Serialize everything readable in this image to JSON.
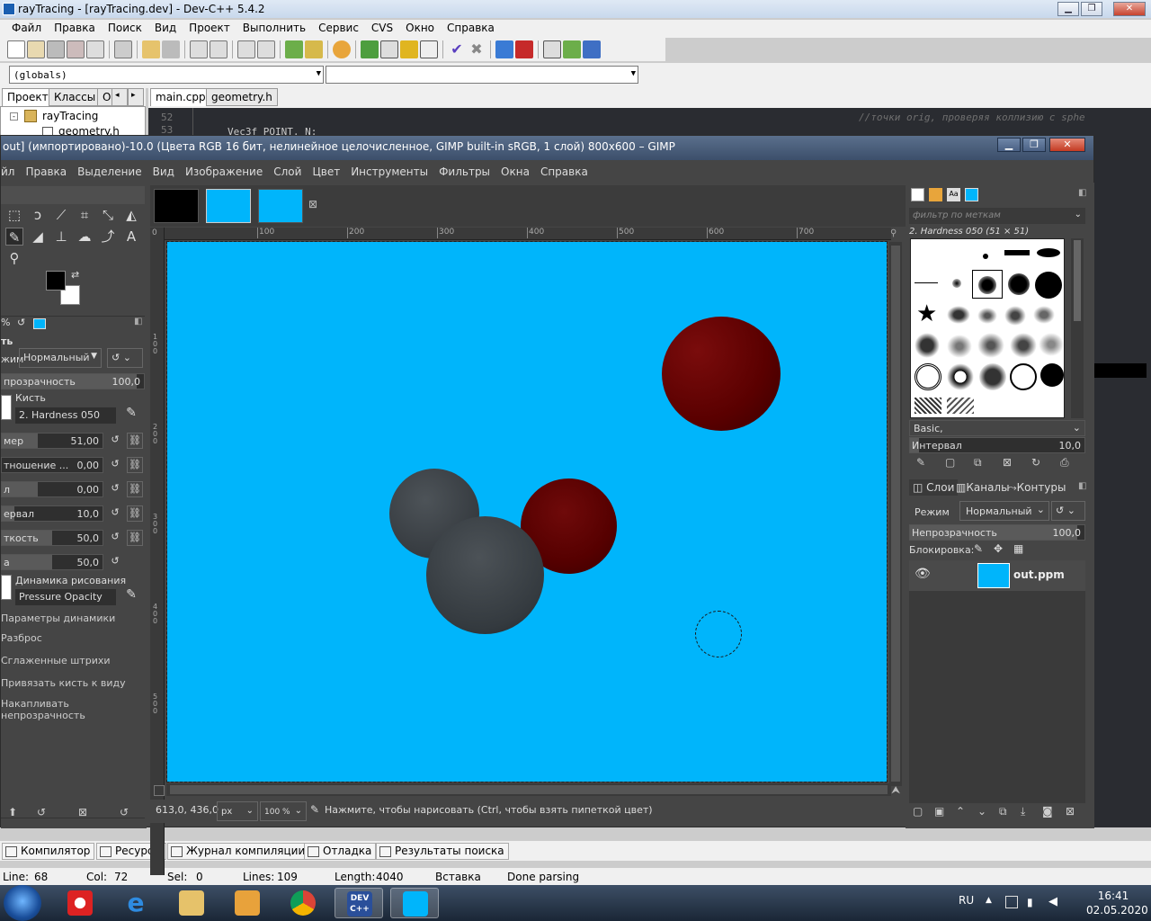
{
  "devcpp": {
    "title": "rayTracing - [rayTracing.dev] - Dev-C++ 5.4.2",
    "menu": [
      "Файл",
      "Правка",
      "Поиск",
      "Вид",
      "Проект",
      "Выполнить",
      "Сервис",
      "CVS",
      "Окно",
      "Справка"
    ],
    "globals_combo": "(globals)",
    "left_tabs": [
      "Проект",
      "Классы",
      "О"
    ],
    "tree_root": "rayTracing",
    "tree_child": "geometry.h",
    "editor_tabs": [
      "main.cpp",
      "geometry.h"
    ],
    "gutter": [
      "52",
      "53"
    ],
    "code_line": "Vec3f POINT, N;",
    "code_comment": "//точки orig, проверяя коллизию с sphe",
    "bottom_tabs": [
      "Компилятор",
      "Ресурсы",
      "Журнал компиляции",
      "Отладка",
      "Результаты поиска"
    ],
    "status": {
      "line_label": "Line:",
      "line": "68",
      "col_label": "Col:",
      "col": "72",
      "sel_label": "Sel:",
      "sel": "0",
      "lines_label": "Lines:",
      "lines": "109",
      "length_label": "Length:",
      "length": "4040",
      "mode": "Вставка",
      "parse": "Done parsing"
    }
  },
  "gimp": {
    "title": "out] (импортировано)-10.0 (Цвета RGB 16 бит, нелинейное целочисленное, GIMP built-in sRGB, 1 слой) 800x600 – GIMP",
    "menu": [
      "йл",
      "Правка",
      "Выделение",
      "Вид",
      "Изображение",
      "Слой",
      "Цвет",
      "Инструменты",
      "Фильтры",
      "Окна",
      "Справка"
    ],
    "ruler_top": [
      "100",
      "200",
      "300",
      "400",
      "500",
      "600",
      "700"
    ],
    "ruler_left": [
      "1 0 0",
      "2 0 0",
      "3 0 0",
      "4 0 0",
      "5 0 0"
    ],
    "tool_options": {
      "section": "ть",
      "mode_label": "жим",
      "mode_value": "Нормальный",
      "opacity_label": "прозрачность",
      "opacity_value": "100,0",
      "brush_label": "Кисть",
      "brush_value": "2. Hardness 050",
      "size_label": "мер",
      "size_value": "51,00",
      "ratio_label": "тношение ...",
      "ratio_value": "0,00",
      "angle_label": "л",
      "angle_value": "0,00",
      "spacing_label": "ервал",
      "spacing_value": "10,0",
      "hardness_label": "ткость",
      "hardness_value": "50,0",
      "force_label": "а",
      "force_value": "50,0",
      "dynamics_label": "Динамика рисования",
      "dynamics_value": "Pressure Opacity",
      "dyn_params": "Параметры динамики",
      "scatter": "Разброс",
      "smooth": "Сглаженные штрихи",
      "lock_brush": "Привязать кисть к виду",
      "accumulate": "Накапливать непрозрачность"
    },
    "status": {
      "coords": "613,0, 436,0",
      "unit": "px",
      "zoom": "100 %",
      "message": "Нажмите, чтобы нарисовать (Ctrl, чтобы взять пипеткой цвет)"
    },
    "dock": {
      "filter_placeholder": "фильтр по меткам",
      "brush_name": "2. Hardness 050 (51 × 51)",
      "brush_set": "Basic,",
      "interval_label": "Интервал",
      "interval_value": "10,0",
      "tabs": [
        "Слои",
        "Каналы",
        "Контуры"
      ],
      "mode_label": "Режим",
      "mode_value": "Нормальный",
      "opacity_label": "Непрозрачность",
      "opacity_value": "100,0",
      "lock_label": "Блокировка:",
      "layer_name": "out.ppm"
    },
    "colors": {
      "canvas": "#00b5fb",
      "panel": "#454545"
    }
  },
  "taskbar": {
    "lang": "RU",
    "time": "16:41",
    "date": "02.05.2020"
  }
}
